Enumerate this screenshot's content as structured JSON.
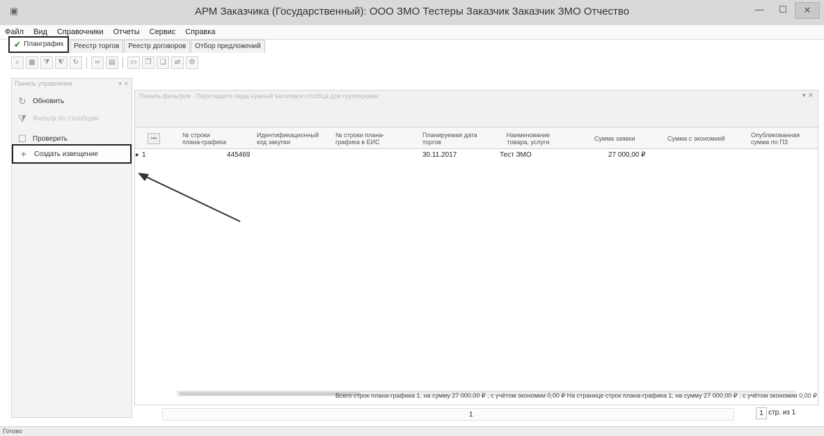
{
  "window": {
    "title": "АРМ Заказчика (Государственный): ООО ЗМО Тестеры Заказчик  Заказчик ЗМО Отчество",
    "controls": [
      "—",
      "☐",
      "✕"
    ]
  },
  "menu": [
    "Файл",
    "Вид",
    "Справочники",
    "Отчеты",
    "Сервис",
    "Справка"
  ],
  "tabs": [
    "Планграфик",
    "Реестр торгов",
    "Реестр договоров",
    "Отбор предложений"
  ],
  "left_panel": {
    "header": "Панель управления",
    "pin": "▾ ✕",
    "refresh_label": "Обновить",
    "filter_label": "Фильтр по столбцам",
    "check_label": "Проверить",
    "create_notice_label": "Создать извещение"
  },
  "filter_panel": {
    "hint": "Панель фильтров · Перетащите сюда нужный заголовок столбца для группировки",
    "close": "▾ ✕"
  },
  "grid": {
    "gear": "•••",
    "columns": [
      "№ строки плана-графика",
      "Идентификационный код закупки",
      "№ строки плана-графика в ЕИС",
      "Планируемая дата торгов",
      "Наименование товара, услуги",
      "Сумма заявки",
      "Сумма с экономией",
      "Опубликованная сумма по ПЗ"
    ],
    "rows": [
      {
        "marker": "▸",
        "index": "1",
        "number": "445469",
        "date": "30.11.2017",
        "name": "Тест ЗМО",
        "amount": "27 000,00 ₽"
      }
    ]
  },
  "summary": "Всего строк плана-графика 1, на сумму 27 000,00 ₽ , с учётом экономии 0,00 ₽ На странице строк плана-графика 1, на сумму 27 000,00 ₽ , с учётом экономии 0,00 ₽",
  "pager": {
    "page_center": "1",
    "page_input": "1",
    "page_of": "стр. из 1"
  },
  "status": "Готово"
}
